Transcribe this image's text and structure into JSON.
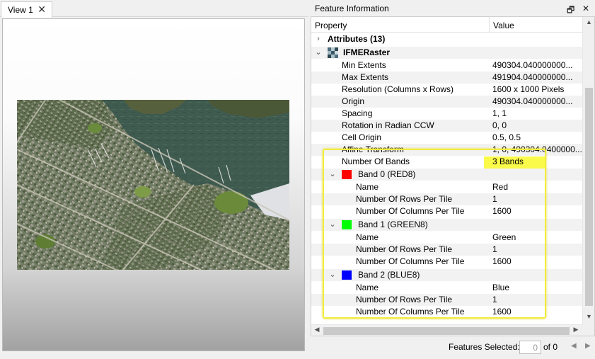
{
  "view": {
    "tab_label": "View 1",
    "tab_close": "✕"
  },
  "panel": {
    "title": "Feature Information",
    "restore_glyph": "🗗",
    "close_glyph": "✕"
  },
  "tree": {
    "header": {
      "property": "Property",
      "value": "Value"
    },
    "attributes_label": "Attributes (13)",
    "raster_label": "IFMERaster",
    "props": [
      {
        "label": "Min Extents",
        "value": "490304.040000000..."
      },
      {
        "label": "Max Extents",
        "value": "491904.040000000..."
      },
      {
        "label": "Resolution (Columns x Rows)",
        "value": "1600 x 1000 Pixels"
      },
      {
        "label": "Origin",
        "value": "490304.040000000..."
      },
      {
        "label": "Spacing",
        "value": "1, 1"
      },
      {
        "label": "Rotation in Radian CCW",
        "value": "0, 0"
      },
      {
        "label": "Cell Origin",
        "value": "0.5, 0.5"
      },
      {
        "label": "Affine Transform",
        "value": "1, 0, 490304.0400000..."
      },
      {
        "label": "Number Of Bands",
        "value": "3 Bands"
      }
    ],
    "bands": [
      {
        "label": "Band 0 (RED8)",
        "color": "#ff0000",
        "fields": [
          {
            "label": "Name",
            "value": "Red"
          },
          {
            "label": "Number Of Rows Per Tile",
            "value": "1"
          },
          {
            "label": "Number Of Columns Per Tile",
            "value": "1600"
          }
        ]
      },
      {
        "label": "Band 1 (GREEN8)",
        "color": "#00ff00",
        "fields": [
          {
            "label": "Name",
            "value": "Green"
          },
          {
            "label": "Number Of Rows Per Tile",
            "value": "1"
          },
          {
            "label": "Number Of Columns Per Tile",
            "value": "1600"
          }
        ]
      },
      {
        "label": "Band 2 (BLUE8)",
        "color": "#0000ff",
        "fields": [
          {
            "label": "Name",
            "value": "Blue"
          },
          {
            "label": "Number Of Rows Per Tile",
            "value": "1"
          },
          {
            "label": "Number Of Columns Per Tile",
            "value": "1600"
          }
        ]
      }
    ]
  },
  "status": {
    "selected_label": "Features Selected:",
    "selected_value": "0",
    "of_label": "of 0"
  },
  "colors": {
    "highlight_border": "#f2ec3c",
    "highlight_fill": "#fafa4a"
  }
}
